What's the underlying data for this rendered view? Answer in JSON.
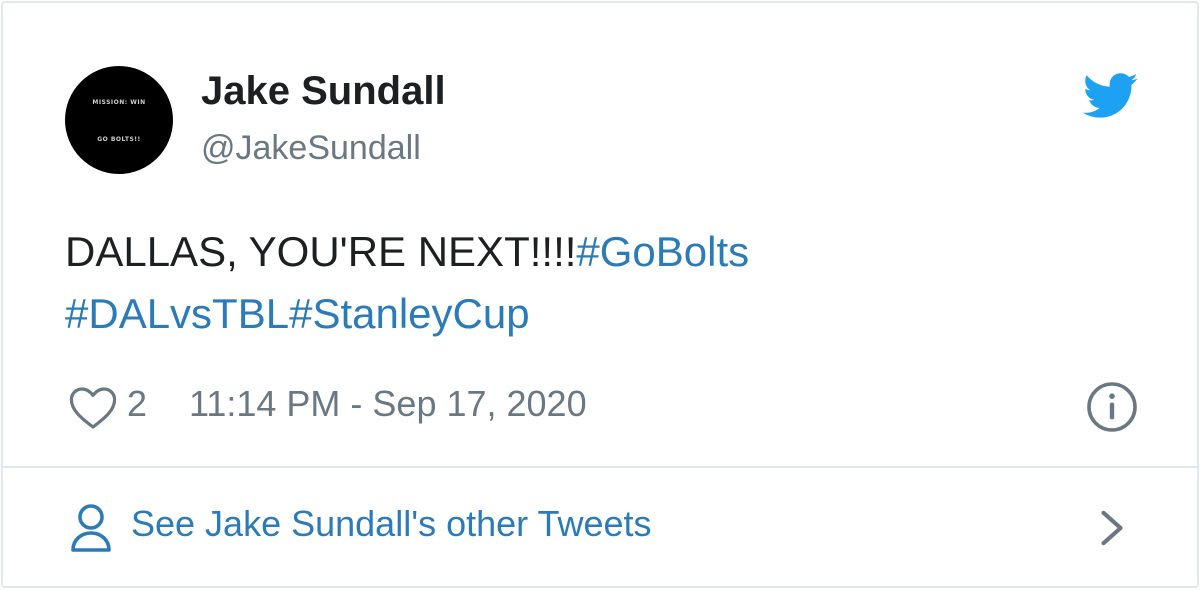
{
  "author": {
    "name": "Jake Sundall",
    "handle": "@JakeSundall",
    "avatar_text_line1": "MISSION: WIN",
    "avatar_text_line2": "GO BOLTS!!"
  },
  "tweet": {
    "text_plain": "DALLAS, YOU'RE NEXT!!!!",
    "hashtags": [
      "#GoBolts",
      "#DALvsTBL",
      "#StanleyCup"
    ]
  },
  "meta": {
    "like_count": "2",
    "timestamp": "11:14 PM - Sep 17, 2020"
  },
  "footer": {
    "more_tweets_label": "See Jake Sundall's other Tweets"
  },
  "icons": {
    "brand": "twitter-bird-icon",
    "like": "heart-icon",
    "info": "info-icon",
    "profile": "person-icon",
    "navigate": "chevron-right-icon"
  },
  "colors": {
    "text": "#1c2022",
    "secondary": "#697882",
    "link": "#2b7bb9",
    "twitter_blue": "#1da1f2",
    "border": "#e1e8ed"
  }
}
